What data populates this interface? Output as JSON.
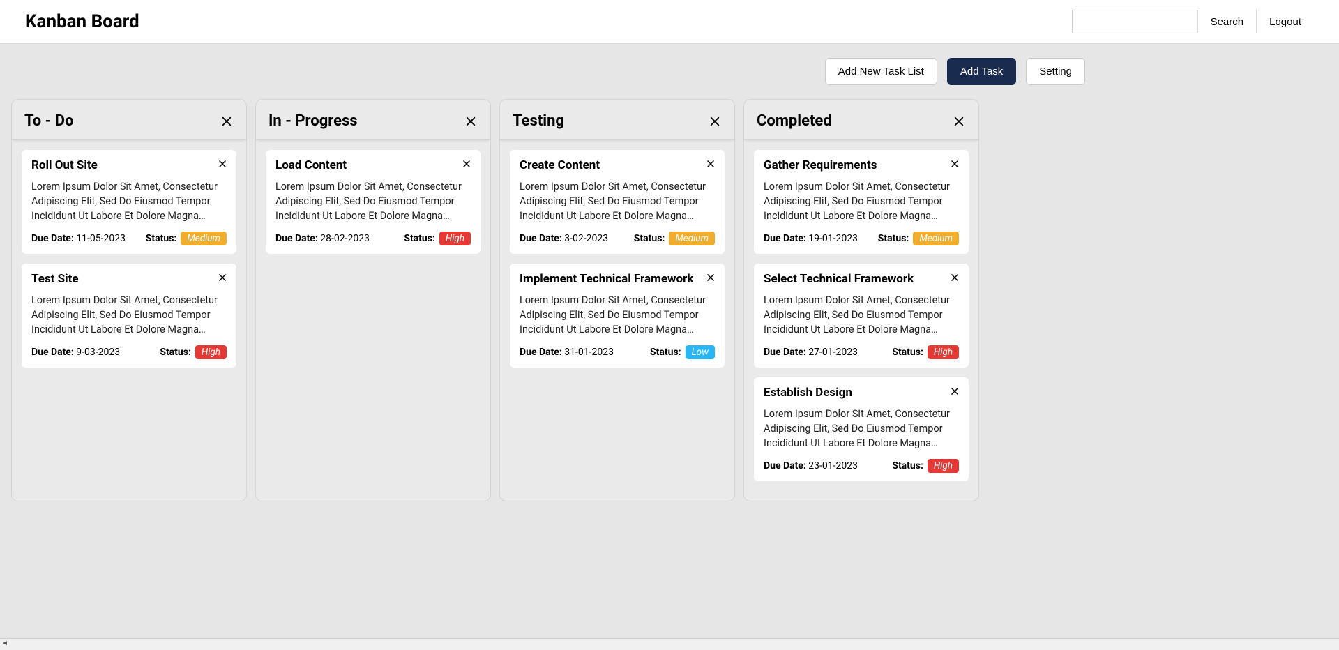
{
  "header": {
    "title": "Kanban Board",
    "search_placeholder": "",
    "search_label": "Search",
    "logout_label": "Logout"
  },
  "actions": {
    "add_list": "Add New Task List",
    "add_task": "Add Task",
    "setting": "Setting"
  },
  "labels": {
    "due_date": "Due Date:",
    "status": "Status:",
    "priority": {
      "high": "High",
      "medium": "Medium",
      "low": "Low"
    }
  },
  "columns": [
    {
      "title": "To - Do",
      "cards": [
        {
          "title": "Roll Out Site",
          "desc": "Lorem Ipsum Dolor Sit Amet, Consectetur Adipiscing Elit, Sed Do Eiusmod Tempor Incididunt Ut Labore Et Dolore Magna Aliqua.",
          "due": "11-05-2023",
          "priority": "medium"
        },
        {
          "title": "Test Site",
          "desc": "Lorem Ipsum Dolor Sit Amet, Consectetur Adipiscing Elit, Sed Do Eiusmod Tempor Incididunt Ut Labore Et Dolore Magna Aliqua.",
          "due": "9-03-2023",
          "priority": "high"
        }
      ]
    },
    {
      "title": "In - Progress",
      "cards": [
        {
          "title": "Load Content",
          "desc": "Lorem Ipsum Dolor Sit Amet, Consectetur Adipiscing Elit, Sed Do Eiusmod Tempor Incididunt Ut Labore Et Dolore Magna Aliqua.",
          "due": "28-02-2023",
          "priority": "high"
        }
      ]
    },
    {
      "title": "Testing",
      "cards": [
        {
          "title": "Create Content",
          "desc": "Lorem Ipsum Dolor Sit Amet, Consectetur Adipiscing Elit, Sed Do Eiusmod Tempor Incididunt Ut Labore Et Dolore Magna Aliqua.",
          "due": "3-02-2023",
          "priority": "medium"
        },
        {
          "title": "Implement Technical Framework",
          "desc": "Lorem Ipsum Dolor Sit Amet, Consectetur Adipiscing Elit, Sed Do Eiusmod Tempor Incididunt Ut Labore Et Dolore Magna Aliqua.",
          "due": "31-01-2023",
          "priority": "low"
        }
      ]
    },
    {
      "title": "Completed",
      "cards": [
        {
          "title": "Gather Requirements",
          "desc": "Lorem Ipsum Dolor Sit Amet, Consectetur Adipiscing Elit, Sed Do Eiusmod Tempor Incididunt Ut Labore Et Dolore Magna Aliqua.",
          "due": "19-01-2023",
          "priority": "medium"
        },
        {
          "title": "Select Technical Framework",
          "desc": "Lorem Ipsum Dolor Sit Amet, Consectetur Adipiscing Elit, Sed Do Eiusmod Tempor Incididunt Ut Labore Et Dolore Magna Aliqua.",
          "due": "27-01-2023",
          "priority": "high"
        },
        {
          "title": "Establish Design",
          "desc": "Lorem Ipsum Dolor Sit Amet, Consectetur Adipiscing Elit, Sed Do Eiusmod Tempor Incididunt Ut Labore Et Dolore Magna Aliqua.",
          "due": "23-01-2023",
          "priority": "high"
        }
      ]
    }
  ]
}
